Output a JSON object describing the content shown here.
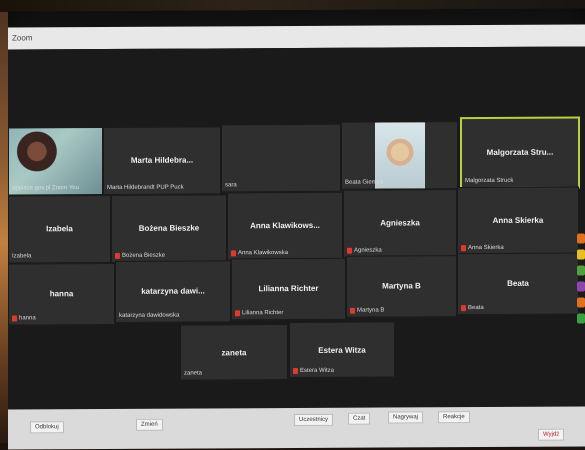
{
  "window": {
    "title": "Zoom"
  },
  "participants": [
    {
      "id": "p1",
      "display_name": "",
      "label": "opplace.gov.pl Zoom You",
      "video": true,
      "muted": false
    },
    {
      "id": "p2",
      "display_name": "Marta Hildebra...",
      "label": "Marta Hildebrandt PUP Puck",
      "video": false,
      "muted": false
    },
    {
      "id": "p3",
      "display_name": "",
      "label": "sara",
      "video": false,
      "muted": false
    },
    {
      "id": "p4",
      "display_name": "",
      "label": "Beata Giemza",
      "video": true,
      "muted": false
    },
    {
      "id": "p5",
      "display_name": "Malgorzata Stru...",
      "label": "Malgorzata Struck",
      "video": false,
      "muted": false,
      "active": true
    },
    {
      "id": "p6",
      "display_name": "Izabela",
      "label": "Izabela",
      "video": false,
      "muted": false
    },
    {
      "id": "p7",
      "display_name": "Bożena Bieszke",
      "label": "Bożena Bieszke",
      "video": false,
      "muted": true
    },
    {
      "id": "p8",
      "display_name": "Anna Klawikows...",
      "label": "Anna Klawikowska",
      "video": false,
      "muted": true
    },
    {
      "id": "p9",
      "display_name": "Agnieszka",
      "label": "Agnieszka",
      "video": false,
      "muted": true
    },
    {
      "id": "p10",
      "display_name": "Anna Skierka",
      "label": "Anna Skierka",
      "video": false,
      "muted": true
    },
    {
      "id": "p11",
      "display_name": "hanna",
      "label": "hanna",
      "video": false,
      "muted": true
    },
    {
      "id": "p12",
      "display_name": "katarzyna dawi...",
      "label": "katarzyna dawidowska",
      "video": false,
      "muted": false
    },
    {
      "id": "p13",
      "display_name": "Lilianna Richter",
      "label": "Lilianna Richter",
      "video": false,
      "muted": true
    },
    {
      "id": "p14",
      "display_name": "Martyna B",
      "label": "Martyna B",
      "video": false,
      "muted": true
    },
    {
      "id": "p15",
      "display_name": "Beata",
      "label": "Beata",
      "video": false,
      "muted": true
    },
    {
      "id": "p16",
      "display_name": "zaneta",
      "label": "zaneta",
      "video": false,
      "muted": false
    },
    {
      "id": "p17",
      "display_name": "Estera Witza",
      "label": "Estera Witza",
      "video": false,
      "muted": true
    }
  ],
  "toolbar": {
    "unmute_label": "Odblokuj",
    "share_label": "Zmień",
    "participants_label": "Uczestnicy",
    "chat_label": "Czat",
    "record_label": "Nagrywaj",
    "reactions_label": "Reakcje",
    "leave_label": "Wyjdź"
  },
  "colors": {
    "tile_bg": "#2f2f2f",
    "active_border": "#b4d23c",
    "mute_icon": "#e0392b"
  }
}
